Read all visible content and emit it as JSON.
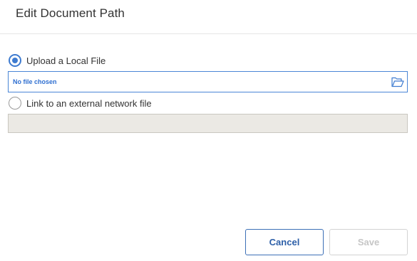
{
  "dialog": {
    "title": "Edit Document Path",
    "options": {
      "upload_label": "Upload a Local File",
      "link_label": "Link to an external network file",
      "selected": "upload"
    },
    "file_input": {
      "value_text": "No file chosen",
      "icon": "folder-open-icon"
    },
    "network_input": {
      "value": "",
      "placeholder": "",
      "disabled": true
    },
    "buttons": {
      "cancel_label": "Cancel",
      "save_label": "Save",
      "save_disabled": true
    },
    "colors": {
      "accent": "#3e7bd0",
      "file_text": "#2f6fd1",
      "disabled_field_bg": "#ebe9e4",
      "disabled_text": "#c6c6c6"
    }
  }
}
